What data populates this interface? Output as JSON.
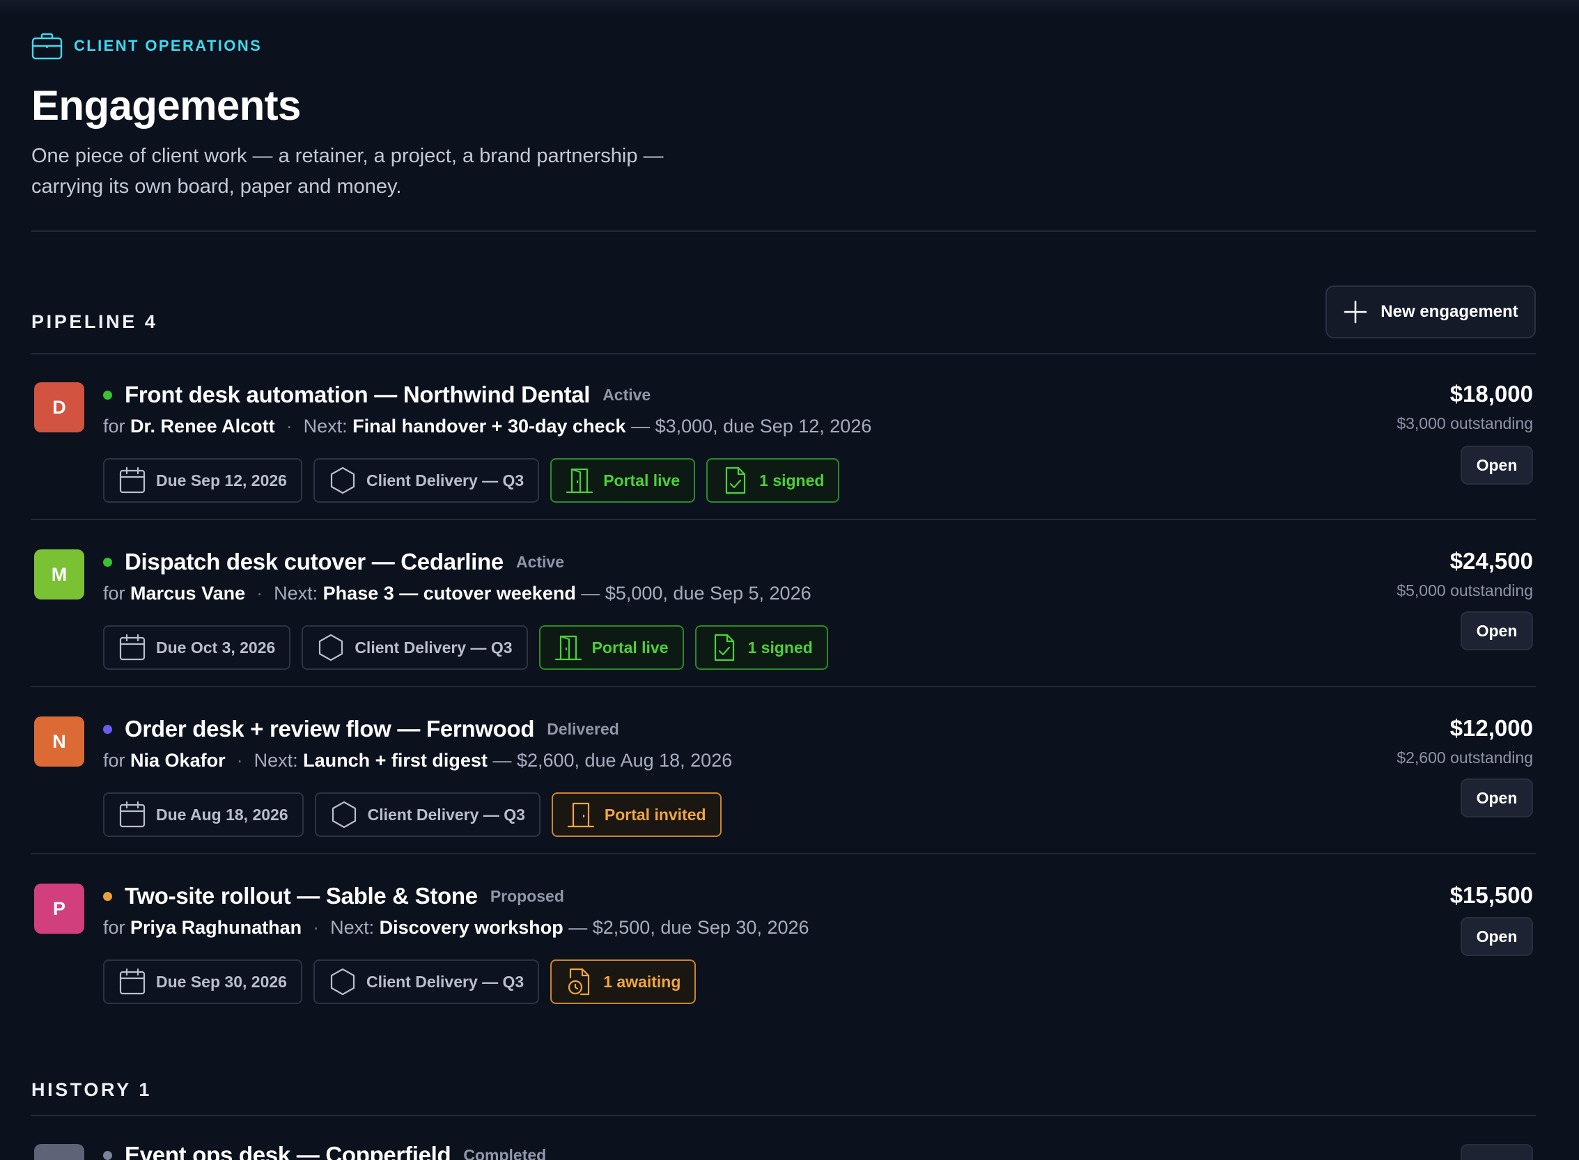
{
  "header": {
    "eyebrow": "CLIENT OPERATIONS",
    "title": "Engagements",
    "subtitle_line1": "One piece of client work — a retainer, a project, a brand partnership —",
    "subtitle_line2": "carrying its own board, paper and money."
  },
  "pipeline": {
    "label": "PIPELINE 4",
    "new_button": "New engagement",
    "rows": [
      {
        "initial": "D",
        "avatar_color": "#d2533f",
        "dot_color": "#39c232",
        "name": "Front desk automation — Northwind Dental",
        "status": "Active",
        "for": "for",
        "client": "Dr. Renee Alcott",
        "next_label": "Next:",
        "next": "Final handover + 30-day check",
        "next_detail": "— $3,000, due Sep 12, 2026",
        "chips": [
          "Due Sep 12, 2026",
          "Client Delivery — Q3",
          "Portal live",
          "1 signed"
        ],
        "amount": "$18,000",
        "outstanding": "$3,000 outstanding",
        "open": "Open"
      },
      {
        "initial": "M",
        "avatar_color": "#7ac234",
        "dot_color": "#39c232",
        "name": "Dispatch desk cutover — Cedarline",
        "status": "Active",
        "for": "for",
        "client": "Marcus Vane",
        "next_label": "Next:",
        "next": "Phase 3 — cutover weekend",
        "next_detail": "— $5,000, due Sep 5, 2026",
        "chips": [
          "Due Oct 3, 2026",
          "Client Delivery — Q3",
          "Portal live",
          "1 signed"
        ],
        "amount": "$24,500",
        "outstanding": "$5,000 outstanding",
        "open": "Open"
      },
      {
        "initial": "N",
        "avatar_color": "#dc6a35",
        "dot_color": "#6b5cf0",
        "name": "Order desk + review flow — Fernwood",
        "status": "Delivered",
        "for": "for",
        "client": "Nia Okafor",
        "next_label": "Next:",
        "next": "Launch + first digest",
        "next_detail": "— $2,600, due Aug 18, 2026",
        "chips": [
          "Due Aug 18, 2026",
          "Client Delivery — Q3",
          "Portal invited"
        ],
        "amount": "$12,000",
        "outstanding": "$2,600 outstanding",
        "open": "Open"
      },
      {
        "initial": "P",
        "avatar_color": "#d13f7c",
        "dot_color": "#e8a13a",
        "name": "Two-site rollout — Sable & Stone",
        "status": "Proposed",
        "for": "for",
        "client": "Priya Raghunathan",
        "next_label": "Next:",
        "next": "Discovery workshop",
        "next_detail": "— $2,500, due Sep 30, 2026",
        "chips": [
          "Due Sep 30, 2026",
          "Client Delivery — Q3",
          "1 awaiting"
        ],
        "amount": "$15,500",
        "open": "Open"
      }
    ]
  },
  "history": {
    "label": "HISTORY 1",
    "rows": [
      {
        "name": "Event ops desk — Copperfield",
        "status": "Completed",
        "avatar_color": "#5d6478",
        "dot_color": "#7d8496"
      }
    ]
  },
  "colors": {
    "accent": "#3fd9ee",
    "live": "#4cd137",
    "awaiting": "#f0a640",
    "background": "#0c111e"
  }
}
